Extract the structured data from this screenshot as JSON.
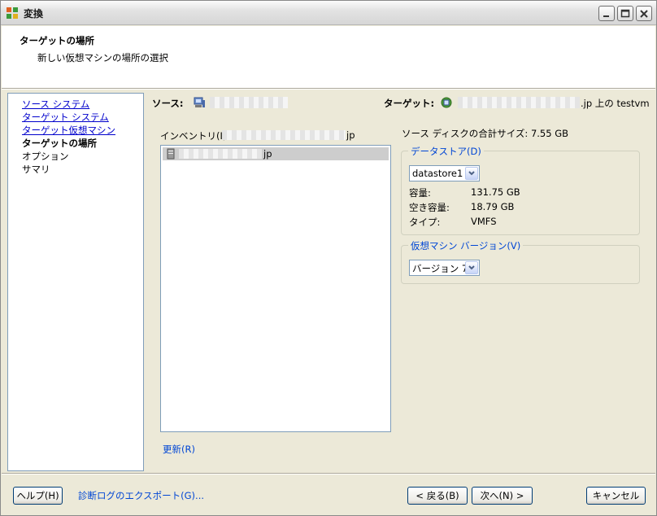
{
  "window": {
    "title": "変換"
  },
  "header": {
    "step_title": "ターゲットの場所",
    "step_subtitle": "新しい仮想マシンの場所の選択"
  },
  "nav": {
    "items": [
      {
        "label": "ソース システム",
        "state": "link"
      },
      {
        "label": "ターゲット システム",
        "state": "link"
      },
      {
        "label": "ターゲット仮想マシン",
        "state": "link"
      },
      {
        "label": "ターゲットの場所",
        "state": "current"
      },
      {
        "label": "オプション",
        "state": "inactive"
      },
      {
        "label": "サマリ",
        "state": "inactive"
      }
    ]
  },
  "main": {
    "source_label": "ソース:",
    "target_label": "ターゲット:",
    "target_value_suffix": ".jp 上の testvm",
    "inventory_label": "インベントリ(I):",
    "inventory_host_suffix": "jp",
    "inventory_item_suffix": "jp",
    "refresh_link": "更新(R)",
    "total_disk_size": "ソース ディスクの合計サイズ:  7.55 GB",
    "datastore": {
      "legend": "データストア(D)",
      "selected": "datastore1",
      "capacity_label": "容量:",
      "capacity_value": "131.75 GB",
      "free_label": "空き容量:",
      "free_value": "18.79 GB",
      "type_label": "タイプ:",
      "type_value": "VMFS"
    },
    "vm_version": {
      "legend": "仮想マシン バージョン(V)",
      "selected": "バージョン 7"
    }
  },
  "footer": {
    "help_button": "ヘルプ(H)",
    "export_link": "診断ログのエクスポート(G)...",
    "back_button": "< 戻る(B)",
    "next_button": "次へ(N) >",
    "cancel_button": "キャンセル"
  }
}
